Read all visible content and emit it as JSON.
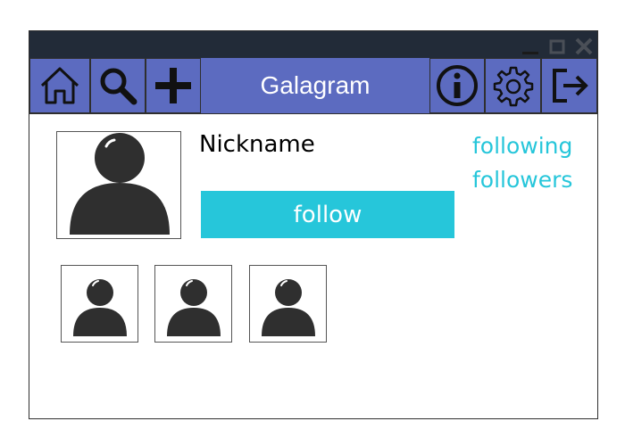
{
  "window": {
    "controls": {
      "minimize_icon": "minimize-icon",
      "maximize_icon": "maximize-icon",
      "close_icon": "close-icon"
    }
  },
  "navbar": {
    "app_title": "Galagram",
    "icons": [
      "home-icon",
      "search-icon",
      "plus-icon",
      "info-icon",
      "gear-icon",
      "logout-icon"
    ]
  },
  "profile": {
    "nickname": "Nickname",
    "follow_label": "follow",
    "following_label": "following",
    "followers_label": "followers"
  },
  "colors": {
    "titlebar": "#222b38",
    "navbar": "#5c6bc0",
    "accent": "#26c6da",
    "avatar": "#2f2f2f"
  }
}
